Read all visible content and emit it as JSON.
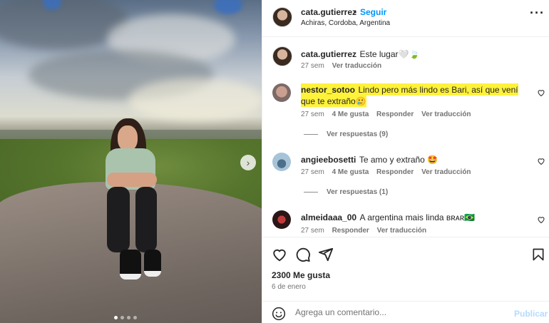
{
  "post": {
    "author": "cata.gutierrez",
    "separator": "•",
    "follow_label": "Seguir",
    "location": "Achiras, Cordoba, Argentina",
    "more_label": "···"
  },
  "caption": {
    "username": "cata.gutierrez",
    "text": "Este lugar🤍🍃",
    "time": "27 sem",
    "translate": "Ver traducción"
  },
  "comments": [
    {
      "username": "nestor_sotoo",
      "text": "Lindo pero más lindo es Bari, así que vení que te extraño🥲",
      "time": "27 sem",
      "likes": "4 Me gusta",
      "reply": "Responder",
      "translate": "Ver traducción",
      "replies": "Ver respuestas (9)"
    },
    {
      "username": "angieebosetti",
      "text": "Te amo y extraño 🤩",
      "time": "27 sem",
      "likes": "4 Me gusta",
      "reply": "Responder",
      "translate": "Ver traducción",
      "replies": "Ver respuestas (1)"
    },
    {
      "username": "almeidaaa_00",
      "text": "A argentina mais linda ʙʀᴀʀ🇧🇷",
      "time": "27 sem",
      "reply": "Responder",
      "translate": "Ver traducción"
    }
  ],
  "footer": {
    "likes": "2300 Me gusta",
    "date": "6 de enero",
    "comment_placeholder": "Agrega un comentario...",
    "publish_label": "Publicar"
  },
  "colors": {
    "link_blue": "#0095f6",
    "highlight": "#fff23a",
    "muted": "#737373"
  },
  "carousel": {
    "dots_total": 4,
    "dot_active": 1,
    "next_icon": "chevron-right-icon"
  }
}
